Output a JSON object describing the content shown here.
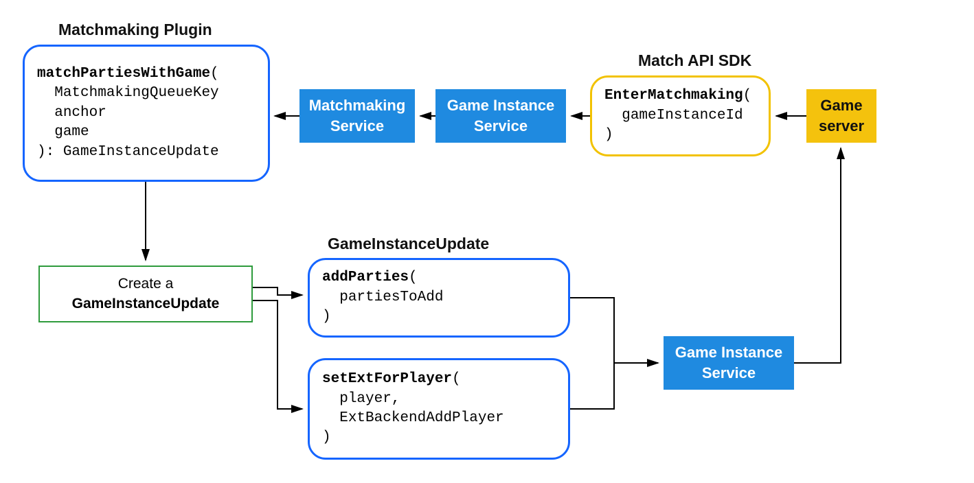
{
  "labels": {
    "matchmaking_plugin": "Matchmaking Plugin",
    "match_api_sdk": "Match API SDK",
    "game_instance_update": "GameInstanceUpdate"
  },
  "nodes": {
    "match_parties": {
      "fn": "matchPartiesWithGame",
      "params": [
        "MatchmakingQueueKey",
        "anchor",
        "game"
      ],
      "ret": "GameInstanceUpdate"
    },
    "matchmaking_service": "Matchmaking\nService",
    "game_instance_service_top": "Game Instance\nService",
    "enter_matchmaking": {
      "fn": "EnterMatchmaking",
      "params": [
        "gameInstanceId"
      ]
    },
    "game_server": "Game\nserver",
    "create_giu_line1": "Create a",
    "create_giu_line2": "GameInstanceUpdate",
    "add_parties": {
      "fn": "addParties",
      "params": [
        "partiesToAdd"
      ]
    },
    "set_ext": {
      "fn": "setExtForPlayer",
      "params": [
        "player,",
        "ExtBackendAddPlayer"
      ]
    },
    "game_instance_service_bottom": "Game Instance\nService"
  },
  "colors": {
    "blue_border": "#1565ff",
    "yellow_border": "#f2c200",
    "green_border": "#2e9b3c",
    "blue_fill": "#1f8ae0",
    "yellow_fill": "#f4c20d",
    "arrow": "#000000"
  }
}
